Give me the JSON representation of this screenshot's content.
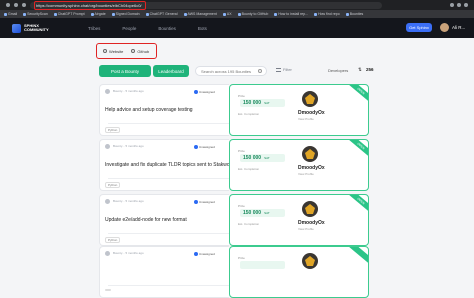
{
  "browser": {
    "url": "https://community.sphinx.chat/org/bounties/elbCh04cpe6c0/",
    "bookmarks": [
      "Gmail",
      "SecurityScan",
      "ChatGPT Prompt",
      "Airgate",
      "Signed Domain",
      "ChatGPT General",
      "AWS Management",
      "UX",
      "Bounty to GitHub",
      "How to install rep...",
      "How find repo",
      "Bounties"
    ]
  },
  "header": {
    "logo_text": "SPHINX COMMUNITY",
    "nav": [
      "Tribes",
      "People",
      "Bounties",
      "Bots"
    ],
    "get_sphinx": "Get Sphinx",
    "user_name": "Ali R..."
  },
  "filters": {
    "sites": [
      {
        "label": "Website"
      },
      {
        "label": "Github"
      }
    ],
    "post_button": "Post a Bounty",
    "leaderboard_button": "Leaderboard",
    "search_placeholder": "Search across 195 Bounties",
    "filter_label": "Filter",
    "sort_label": "Developers",
    "count": "256"
  },
  "bounties": [
    {
      "meta": "Bounty...\n5 months ago",
      "status": "Unassigned",
      "title": "Help advice and setup coverage testing",
      "tag": "Python",
      "prize_label": "Prize",
      "amount": "150 000",
      "unit": "SAT",
      "est": "Est. Completion",
      "org": "DmoodyOx",
      "org_sub": "View Profile",
      "ribbon": "OPEN"
    },
    {
      "meta": "Bounty...\n5 months ago",
      "status": "Unassigned",
      "title": "Investigate and fix duplicate TLDR topics sent to Stakwork",
      "tag": "Python",
      "prize_label": "Prize",
      "amount": "150 000",
      "unit": "SAT",
      "est": "Est. Completion",
      "org": "DmoodyOx",
      "org_sub": "View Profile",
      "ribbon": "OPEN"
    },
    {
      "meta": "Bounty...\n5 months ago",
      "status": "Unassigned",
      "title": "Update e2e/add-node for new format",
      "tag": "Python",
      "prize_label": "Prize",
      "amount": "150 000",
      "unit": "SAT",
      "est": "Est. Completion",
      "org": "DmoodyOx",
      "org_sub": "View Profile",
      "ribbon": "OPEN"
    },
    {
      "meta": "Bounty...\n5 months ago",
      "status": "Unassigned",
      "title": "",
      "tag": "",
      "prize_label": "Prize",
      "amount": "",
      "unit": "",
      "est": "",
      "org": "",
      "org_sub": "",
      "ribbon": ""
    }
  ]
}
